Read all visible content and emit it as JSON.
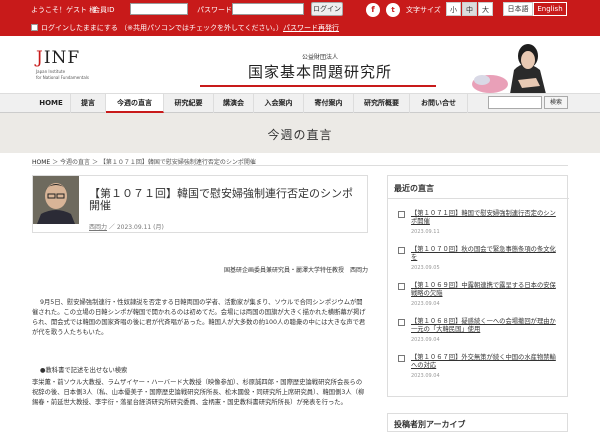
{
  "topbar": {
    "welcome": "ようこそ！ゲスト 様",
    "id_label": "会員ID",
    "pw_label": "パスワード",
    "login_button": "ログイン",
    "keep_login": "ログインしたままにする （※共用パソコンではチェックを外してください。）",
    "forgot_pw": "パスワード再発行",
    "font_size_label": "文字サイズ",
    "font_sizes": [
      "小",
      "中",
      "大"
    ],
    "font_size_selected": "中",
    "languages": [
      "日本語",
      "English"
    ],
    "social": [
      "facebook-icon",
      "twitter-icon"
    ]
  },
  "header": {
    "logo_text": "JINF",
    "logo_sub1": "Japan Institute",
    "logo_sub2": "for National Fundamentals",
    "org_type": "公益財団法人",
    "org_name": "国家基本問題研究所"
  },
  "nav": {
    "items": [
      "HOME",
      "提言",
      "今週の直言",
      "研究紀要",
      "講演会",
      "入会案内",
      "寄付案内",
      "研究所概要",
      "お問い合せ"
    ],
    "active": "今週の直言",
    "search_button": "検索"
  },
  "page": {
    "title": "今週の直言",
    "breadcrumb": [
      "HOME",
      "今週の直言",
      "【第１０７１回】韓国で慰安婦強制連行否定のシンポ開催"
    ]
  },
  "article": {
    "title": "【第１０７１回】韓国で慰安婦強制連行否定のシンポ開催",
    "author": "西岡力",
    "date": "2023.09.11 (月)",
    "byline": "国基研企画委員兼研究員・麗澤大学特任教授　西岡力",
    "para1": "9月5日、慰安婦強制連行・性奴隷説を否定する日韓両国の学者、活動家が集まり、ソウルで合同シンポジウムが開催された。この立場の日韓シンポが韓国で開かれるのは初めてだ。会場には両国の国旗が大きく描かれた横断幕が掲げられ、開会式では韓国の国家斉唱の後に君が代斉唱があった。韓国人が大多数の約100人の聴衆の中には大きな声で君が代を歌う人たちもいた。",
    "para2": "●教科書で記述を出せない検索",
    "para3": "李栄薫・前ソウル大教授、ラムザイヤー・ハーバード大教授（映像参加）、杉原誠四郎・国際歴史論戦研究所会長らの祝辞の後、日本側3人（私、山本優美子・国際歴史論戦研究所所長、松木國俊・同研究所上席研究員）、韓国側3人（柳錫春・前延世大教授、李宇衍・落星台経済研究所研究委員、金柄憲・国史教科書研究所所長）が発表を行った。"
  },
  "sidebar": {
    "heading": "最近の直言",
    "items": [
      {
        "title": "【第１０７１回】韓国で慰安婦強制連行否定のシンポ開催",
        "date": "2023.09.11"
      },
      {
        "title": "【第１０７０回】秋の国会で緊急事態条項の条文化を",
        "date": "2023.09.05"
      },
      {
        "title": "【第１０６９回】中露朝連携で露呈する日本の安保戦略の欠陥",
        "date": "2023.09.04"
      },
      {
        "title": "【第１０６８回】疑惑続く一への会場撤回が理由か一元の「大韓民国」使用",
        "date": "2023.09.04"
      },
      {
        "title": "【第１０６７回】外交無策が続く中国の水産物禁輸への対応",
        "date": "2023.09.04"
      }
    ],
    "archive_heading": "投稿者別アーカイブ"
  }
}
